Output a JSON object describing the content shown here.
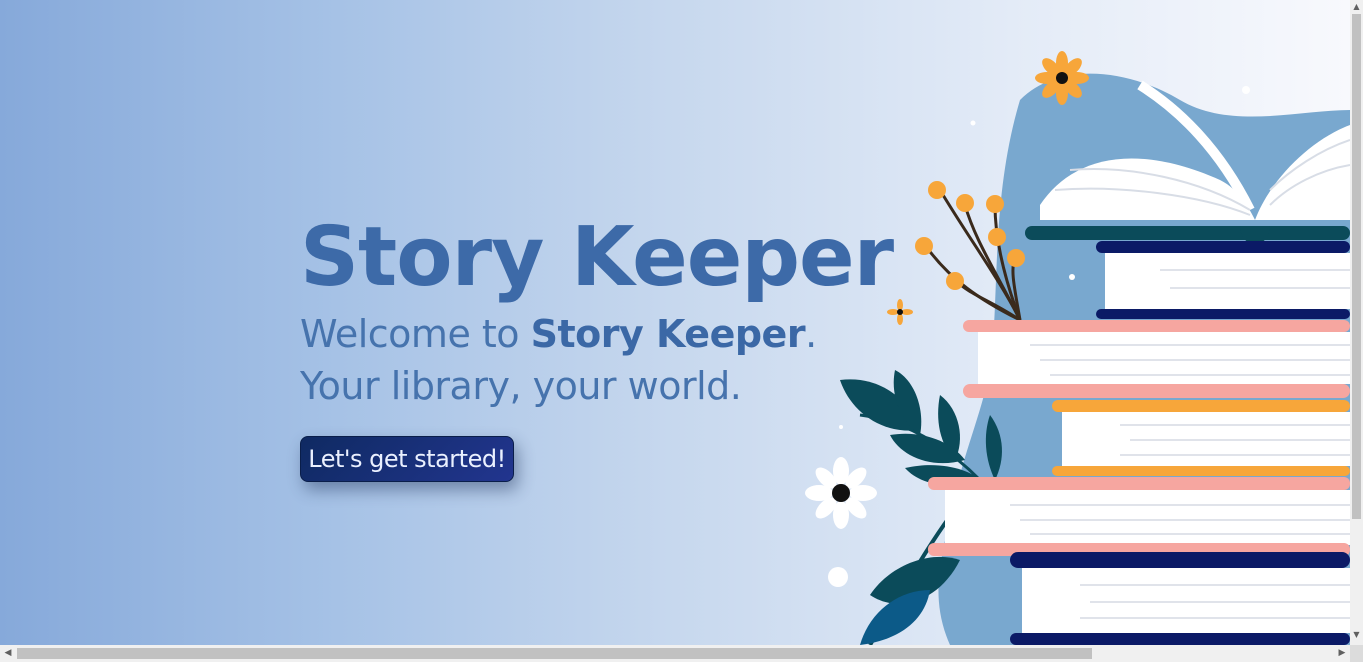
{
  "hero": {
    "title": "Story Keeper",
    "welcome_prefix": "Welcome to ",
    "welcome_brand": "Story Keeper",
    "welcome_suffix": ".",
    "tagline": "Your library, your world.",
    "cta_label": "Let's get started!"
  },
  "colors": {
    "title": "#3d6aa8",
    "button_bg": "#0f2a62",
    "book_navy": "#0b1a66",
    "book_pink": "#f6a6a0",
    "book_orange": "#f7a63a",
    "book_teal": "#0b4b5a"
  },
  "illustration": {
    "icons": [
      "open-book-icon",
      "book-stack-icon",
      "flower-icon",
      "leaf-branch-icon",
      "berry-branch-icon"
    ]
  },
  "scrollbars": {
    "arrow_up": "▲",
    "arrow_down": "▼",
    "arrow_left": "◀",
    "arrow_right": "▶"
  }
}
